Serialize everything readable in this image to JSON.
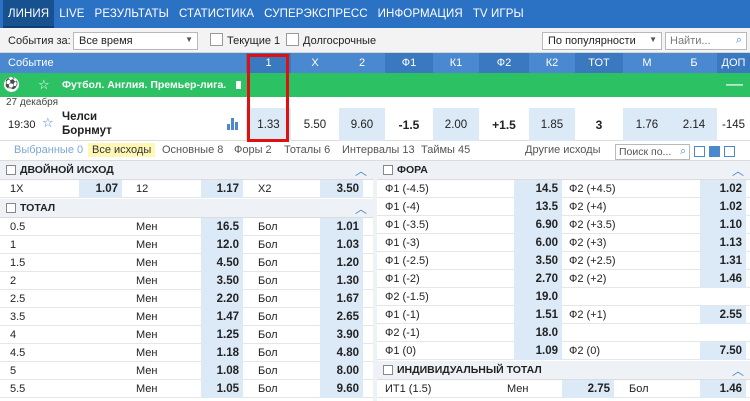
{
  "nav": [
    "ЛИНИЯ",
    "LIVE",
    "РЕЗУЛЬТАТЫ",
    "СТАТИСТИКА",
    "СУПЕРЭКСПРЕСС",
    "ИНФОРМАЦИЯ",
    "TV ИГРЫ"
  ],
  "filter": {
    "events_label": "События за:",
    "period_value": "Все время",
    "current_label": "Текущие 1",
    "longterm_label": "Долгосрочные",
    "sort_value": "По популярности",
    "search_placeholder": "Найти..."
  },
  "header": {
    "event": "Событие",
    "cols": [
      "1",
      "X",
      "2",
      "Ф1",
      "К1",
      "Ф2",
      "К2",
      "ТОТ",
      "М",
      "Б",
      "ДОП"
    ]
  },
  "league": {
    "title": "Футбол. Англия. Премьер-лига."
  },
  "date": "27 декабря",
  "match": {
    "time": "19:30",
    "team1": "Челси",
    "team2": "Борнмут",
    "odds": [
      "1.33",
      "5.50",
      "9.60",
      "-1.5",
      "2.00",
      "+1.5",
      "1.85",
      "3",
      "1.76",
      "2.14",
      "-145"
    ]
  },
  "tabs": [
    "Выбранные 0",
    "Все исходы",
    "Основные 8",
    "Форы 2",
    "Тоталы 6",
    "Интервалы 13",
    "Таймы 45",
    "Другие исходы"
  ],
  "tab_search": "Поиск по...",
  "double": {
    "title": "ДВОЙНОЙ ИСХОД",
    "items": [
      [
        "1X",
        "1.07"
      ],
      [
        "12",
        "1.17"
      ],
      [
        "X2",
        "3.50"
      ]
    ]
  },
  "total": {
    "title": "ТОТАЛ",
    "rows": [
      [
        "0.5",
        "Мен",
        "16.5",
        "Бол",
        "1.01"
      ],
      [
        "1",
        "Мен",
        "12.0",
        "Бол",
        "1.03"
      ],
      [
        "1.5",
        "Мен",
        "4.50",
        "Бол",
        "1.20"
      ],
      [
        "2",
        "Мен",
        "3.50",
        "Бол",
        "1.30"
      ],
      [
        "2.5",
        "Мен",
        "2.20",
        "Бол",
        "1.67"
      ],
      [
        "3.5",
        "Мен",
        "1.47",
        "Бол",
        "2.65"
      ],
      [
        "4",
        "Мен",
        "1.25",
        "Бол",
        "3.90"
      ],
      [
        "4.5",
        "Мен",
        "1.18",
        "Бол",
        "4.80"
      ],
      [
        "5",
        "Мен",
        "1.08",
        "Бол",
        "8.00"
      ],
      [
        "5.5",
        "Мен",
        "1.05",
        "Бол",
        "9.60"
      ]
    ]
  },
  "fora": {
    "title": "ФОРА",
    "rows": [
      [
        "Ф1 (-4.5)",
        "14.5",
        "Ф2 (+4.5)",
        "1.02"
      ],
      [
        "Ф1 (-4)",
        "13.5",
        "Ф2 (+4)",
        "1.02"
      ],
      [
        "Ф1 (-3.5)",
        "6.90",
        "Ф2 (+3.5)",
        "1.10"
      ],
      [
        "Ф1 (-3)",
        "6.00",
        "Ф2 (+3)",
        "1.13"
      ],
      [
        "Ф1 (-2.5)",
        "3.50",
        "Ф2 (+2.5)",
        "1.31"
      ],
      [
        "Ф1 (-2)",
        "2.70",
        "Ф2 (+2)",
        "1.46"
      ],
      [
        "Ф2 (-1.5)",
        "19.0",
        "",
        ""
      ],
      [
        "Ф1 (-1)",
        "1.51",
        "Ф2 (+1)",
        "2.55"
      ],
      [
        "Ф2 (-1)",
        "18.0",
        "",
        ""
      ],
      [
        "Ф1 (0)",
        "1.09",
        "Ф2 (0)",
        "7.50"
      ]
    ]
  },
  "ind_total": {
    "title": "ИНДИВИДУАЛЬНЫЙ ТОТАЛ",
    "row": [
      "ИТ1 (1.5)",
      "Мен",
      "2.75",
      "Бол",
      "1.46"
    ]
  }
}
